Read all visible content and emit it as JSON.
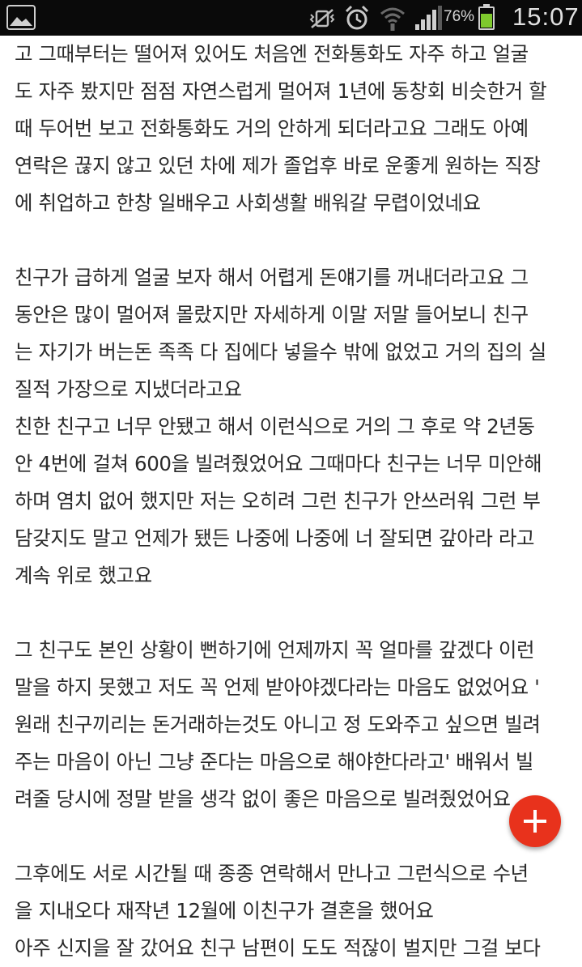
{
  "status_bar": {
    "battery_percent_text": "76%",
    "battery_level": 0.76,
    "time": "15:07",
    "battery_color": "#7ec92d",
    "icons": [
      "gallery-notification-icon",
      "vibrate-mute-icon",
      "alarm-clock-icon",
      "wifi-icon",
      "cell-signal-icon",
      "battery-icon"
    ]
  },
  "article": {
    "lines": [
      "고 그때부터는 떨어져 있어도 처음엔 전화통화도 자주 하고 얼굴",
      "도 자주 봤지만 점점 자연스럽게 멀어져 1년에 동창회 비슷한거 할",
      "때 두어번 보고 전화통화도 거의 안하게 되더라고요 그래도 아예",
      "연락은 끊지 않고 있던 차에 제가 졸업후 바로 운좋게 원하는 직장",
      "에 취업하고 한창 일배우고 사회생활 배워갈 무렵이었네요",
      "",
      "친구가 급하게 얼굴 보자 해서 어렵게 돈얘기를 꺼내더라고요 그",
      "동안은 많이 멀어져 몰랐지만 자세하게 이말 저말 들어보니 친구",
      "는 자기가 버는돈 족족 다 집에다 넣을수 밖에 없었고 거의 집의 실",
      "질적 가장으로 지냈더라고요",
      "친한 친구고 너무 안됐고 해서 이런식으로 거의 그 후로 약 2년동",
      "안 4번에 걸쳐 600을 빌려줬었어요 그때마다 친구는 너무 미안해",
      "하며 염치 없어 했지만 저는 오히려 그런 친구가 안쓰러워 그런 부",
      "담갖지도 말고 언제가 됐든 나중에 나중에 너 잘되면 갚아라 라고",
      "계속 위로 했고요",
      "",
      "그 친구도 본인 상황이 뻔하기에 언제까지 꼭 얼마를 갚겠다 이런",
      "말을 하지 못했고 저도 꼭 언제 받아야겠다라는 마음도 없었어요 '",
      "원래 친구끼리는 돈거래하는것도 아니고 정 도와주고 싶으면 빌려",
      "주는 마음이 아닌 그냥 준다는 마음으로 해야한다라고' 배워서 빌",
      "려줄 당시에 정말 받을 생각 없이 좋은 마음으로 빌려줬었어요",
      "",
      "그후에도 서로 시간될 때 종종 연락해서 만나고 그런식으로 수년",
      "을 지내오다 재작년 12월에 이친구가 결혼을 했어요",
      "아주 신지을 잘 갔어요 친구 남편이 도도 적잖이 벌지만 그걸 보다"
    ]
  },
  "fab": {
    "color": "#e8321c",
    "icon": "plus-icon"
  }
}
